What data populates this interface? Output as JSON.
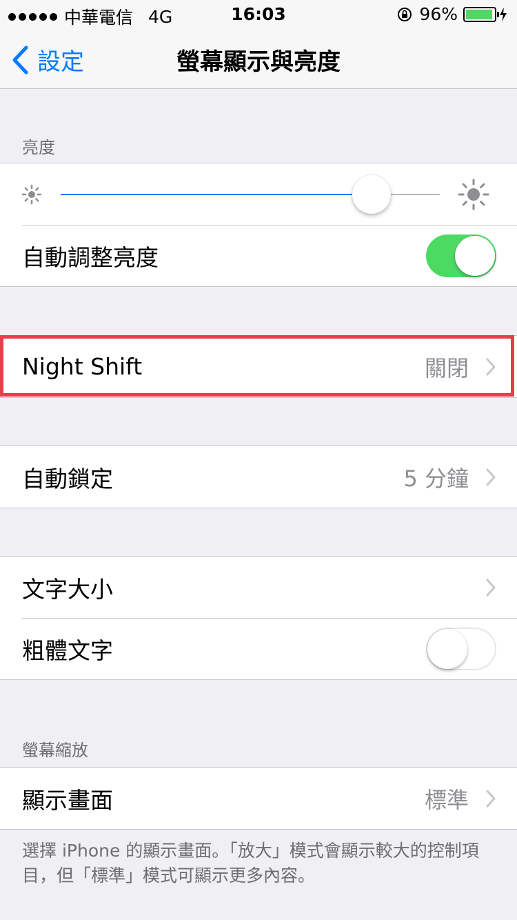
{
  "status_bar": {
    "carrier": "中華電信",
    "network": "4G",
    "time": "16:03",
    "battery_percent": "96%",
    "battery_level": 0.96,
    "battery_color": "#4cd964",
    "icons": [
      "signal-dots-icon",
      "rotation-lock-icon",
      "battery-icon",
      "charging-bolt-icon"
    ]
  },
  "nav": {
    "back_label": "設定",
    "title": "螢幕顯示與亮度"
  },
  "brightness": {
    "header": "亮度",
    "level": 0.82,
    "auto_label": "自動調整亮度",
    "auto_enabled": true
  },
  "night_shift": {
    "label": "Night Shift",
    "value": "關閉"
  },
  "auto_lock": {
    "label": "自動鎖定",
    "value": "5 分鐘"
  },
  "text": {
    "text_size_label": "文字大小",
    "bold_text_label": "粗體文字",
    "bold_text_enabled": false
  },
  "zoom": {
    "header": "螢幕縮放",
    "display_label": "顯示畫面",
    "display_value": "標準",
    "footer": "選擇 iPhone 的顯示畫面。「放大」模式會顯示較大的控制項目，但「標準」模式可顯示更多內容。"
  },
  "colors": {
    "accent": "#007aff",
    "toggle_on": "#4cd964",
    "highlight": "#ec3b4a"
  }
}
